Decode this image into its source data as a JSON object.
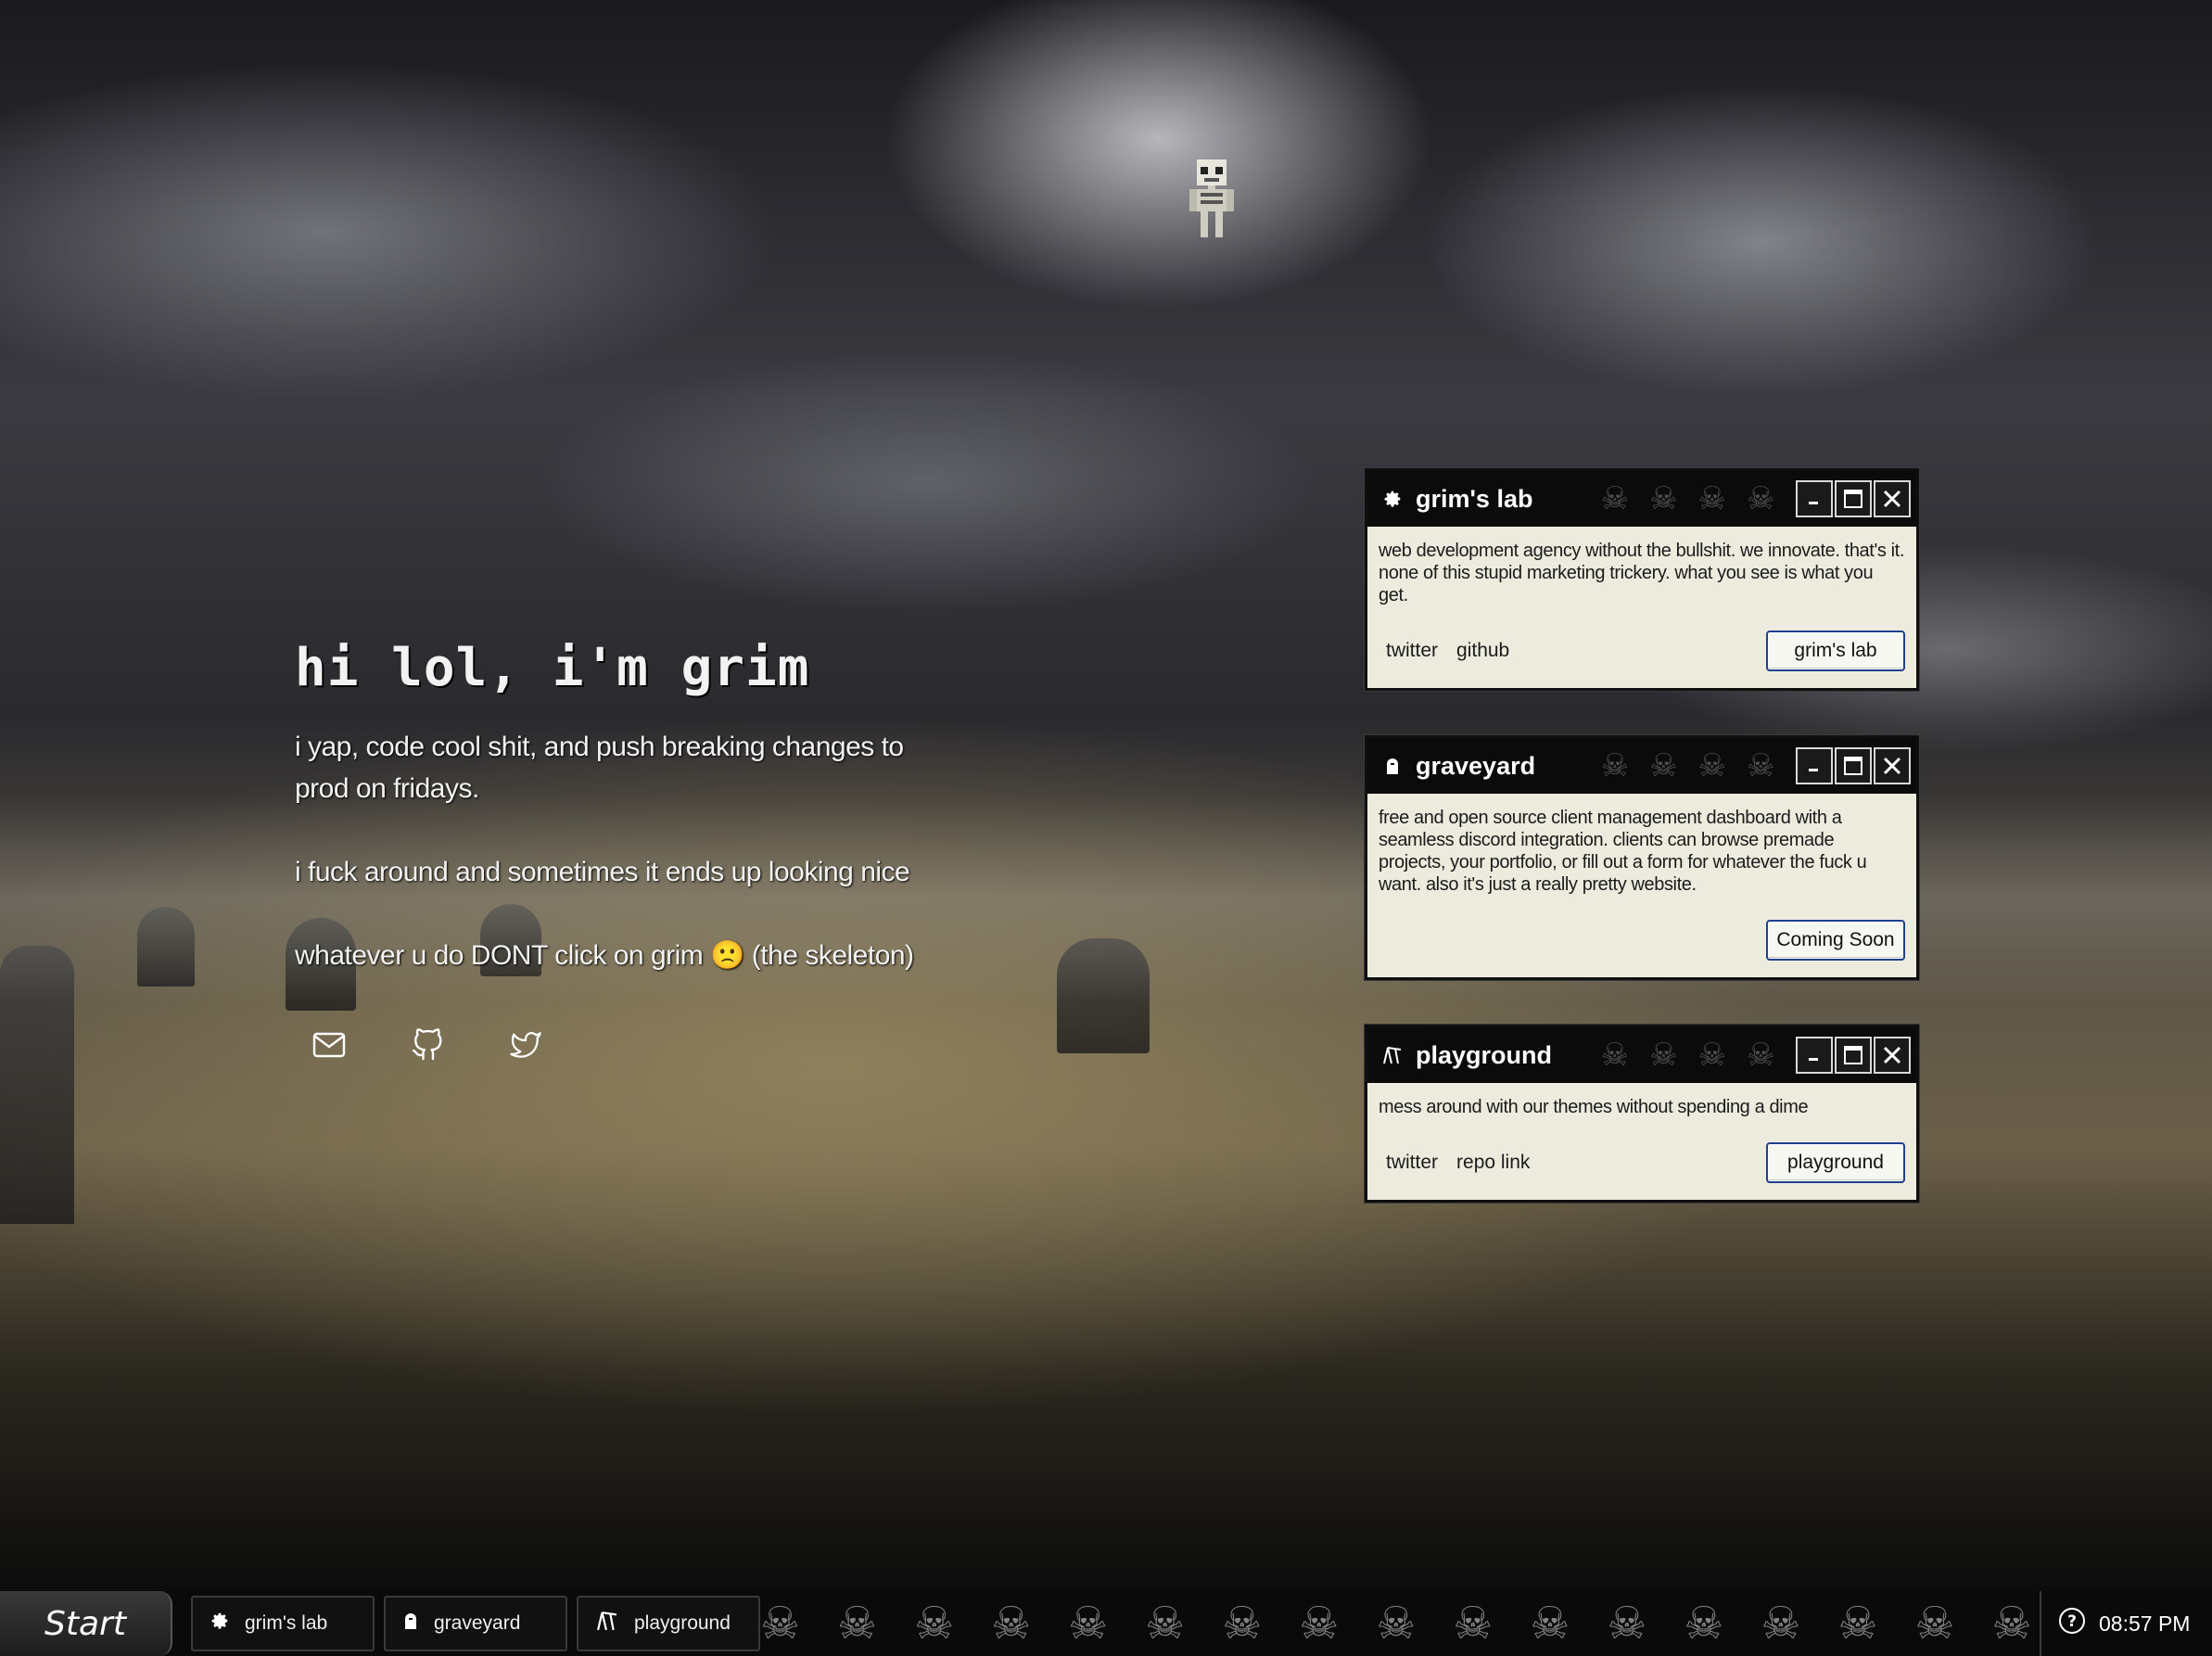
{
  "hero": {
    "heading": "hi lol, i'm grim",
    "lines": [
      "i yap, code cool shit, and push breaking changes to prod on fridays.",
      "i fuck around and sometimes it ends up looking nice",
      "whatever u do DONT click on grim 🙁 (the skeleton)"
    ]
  },
  "socials": [
    "mail-icon",
    "github-icon",
    "twitter-icon"
  ],
  "windows": [
    {
      "title": "grim's lab",
      "icon": "gear-icon",
      "description": "web development agency without the bullshit. we innovate. that's it. none of this stupid marketing trickery. what you see is what you get.",
      "links": [
        "twitter",
        "github"
      ],
      "button": "grim's lab"
    },
    {
      "title": "graveyard",
      "icon": "tombstone-icon",
      "description": "free and open source client management dashboard with a seamless discord integration. clients can browse premade projects, your portfolio, or fill out a form for whatever the fuck u want. also it's just a really pretty website.",
      "links": [],
      "button": "Coming Soon"
    },
    {
      "title": "playground",
      "icon": "playground-icon",
      "description": "mess around with our themes without spending a dime",
      "links": [
        "twitter",
        "repo link"
      ],
      "button": "playground"
    }
  ],
  "taskbar": {
    "start": "Start",
    "tasks": [
      {
        "label": "grim's lab",
        "icon": "gear-icon"
      },
      {
        "label": "graveyard",
        "icon": "tombstone-icon"
      },
      {
        "label": "playground",
        "icon": "playground-icon"
      }
    ],
    "help_icon": "help-icon",
    "clock": "08:57 PM"
  }
}
